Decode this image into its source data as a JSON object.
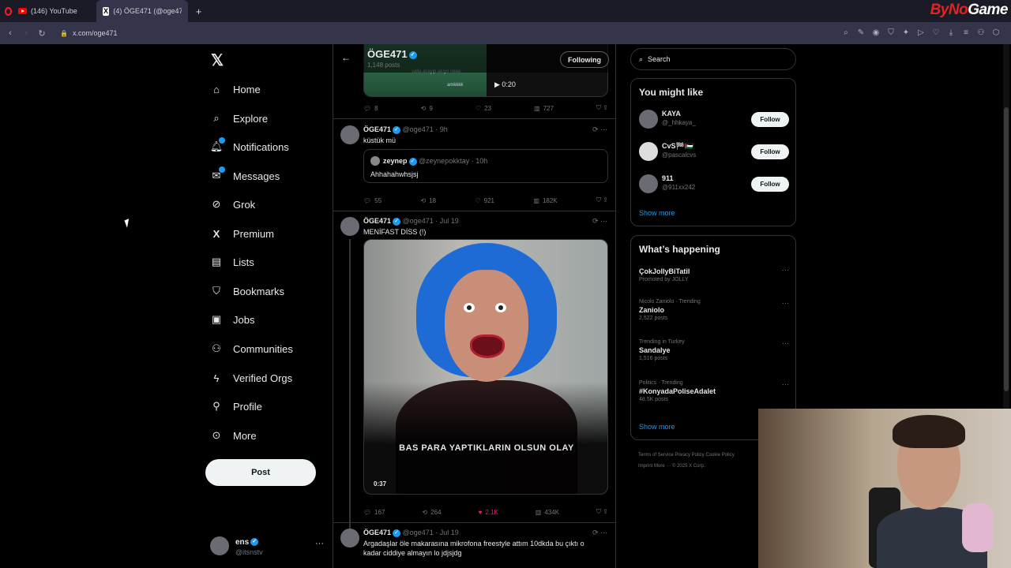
{
  "browser": {
    "tabs": [
      {
        "label": "(146) YouTube"
      },
      {
        "label": "(4) ÖGE471 (@oge471) / X"
      }
    ],
    "url": "x.com/oge471",
    "brand_left": "ByNo",
    "brand_right": "Game"
  },
  "sidebar": {
    "items": [
      {
        "label": "Home",
        "icon": "home-icon"
      },
      {
        "label": "Explore",
        "icon": "search-icon"
      },
      {
        "label": "Notifications",
        "icon": "bell-icon"
      },
      {
        "label": "Messages",
        "icon": "mail-icon"
      },
      {
        "label": "Grok",
        "icon": "grok-icon"
      },
      {
        "label": "Premium",
        "icon": "x-icon"
      },
      {
        "label": "Lists",
        "icon": "list-icon"
      },
      {
        "label": "Bookmarks",
        "icon": "bookmark-icon"
      },
      {
        "label": "Jobs",
        "icon": "briefcase-icon"
      },
      {
        "label": "Communities",
        "icon": "people-icon"
      },
      {
        "label": "Verified Orgs",
        "icon": "lightning-icon"
      },
      {
        "label": "Profile",
        "icon": "person-icon"
      },
      {
        "label": "More",
        "icon": "more-icon"
      }
    ],
    "post_label": "Post",
    "account": {
      "name": "ens",
      "handle": "@itsnstv"
    }
  },
  "feed": {
    "header": {
      "title": "ÖGE471",
      "subtitle": "1,148 posts",
      "following_label": "Following"
    },
    "prev_media": {
      "duration": "0:20",
      "line1": "valla acayip akıyo neee",
      "line2": "amkkkk"
    },
    "prev_actions": {
      "replies": "8",
      "reposts": "9",
      "likes": "23",
      "views": "727"
    },
    "tweets": [
      {
        "name": "ÖGE471",
        "handle": "@oge471",
        "time": "9h",
        "text": "küstük mü",
        "quote": {
          "name": "zeynep",
          "handle": "@zeynepokktay",
          "time": "10h",
          "text": "Ahhahahwhsjsj"
        },
        "actions": {
          "replies": "55",
          "reposts": "18",
          "likes": "921",
          "views": "182K"
        }
      },
      {
        "name": "ÖGE471",
        "handle": "@oge471",
        "time": "Jul 19",
        "text": "MENİFAST DİSS (!)",
        "media": {
          "caption": "BAS PARA YAPTIKLARIN OLSUN OLAY",
          "duration": "0:37"
        },
        "actions": {
          "replies": "167",
          "reposts": "264",
          "likes": "2.1K",
          "views": "434K"
        }
      },
      {
        "name": "ÖGE471",
        "handle": "@oge471",
        "time": "Jul 19",
        "text": "Argadaşlar öle makarasına mikrofona freestyle attım 10dkda bu çıktı o kadar ciddiye almayın lo jdjsjdg"
      }
    ]
  },
  "right": {
    "search_placeholder": "Search",
    "might_like": {
      "title": "You might like",
      "people": [
        {
          "name": "KAYA",
          "handle": "@_hhkaya_"
        },
        {
          "name": "CvS🏁🇵🇸",
          "handle": "@pascalcvs"
        },
        {
          "name": "911",
          "handle": "@911xx242"
        }
      ],
      "follow_label": "Follow",
      "show_more": "Show more"
    },
    "happening": {
      "title": "What’s happening",
      "trends": [
        {
          "meta": "",
          "title": "ÇokJollyBiTatil",
          "count": "Promoted by JOLLY"
        },
        {
          "meta": "Nicolo Zaniolo · Trending",
          "title": "Zaniolo",
          "count": "2,522 posts"
        },
        {
          "meta": "Trending in Turkey",
          "title": "Sandalye",
          "count": "1,516 posts"
        },
        {
          "meta": "Politics · Trending",
          "title": "#KonyadaPoliseAdalet",
          "count": "48.5K posts"
        }
      ],
      "show_more": "Show more"
    },
    "footer": {
      "line1": "Terms of Service   Privacy Policy   Cookie Policy",
      "line2": "Imprint   More ···   © 2025 X Corp."
    }
  }
}
